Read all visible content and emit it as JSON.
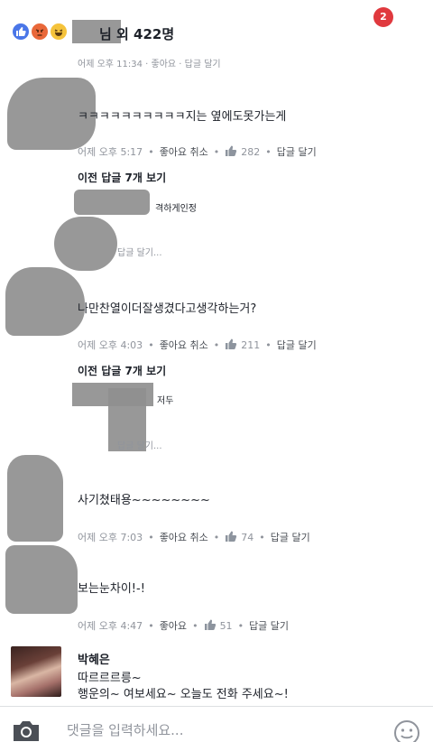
{
  "header": {
    "reaction_icons": [
      "like-icon",
      "angry-icon",
      "haha-icon"
    ],
    "text": "님 외 422명",
    "notification_count": "2",
    "sub_meta": "어제 오후 11:34 · 좋아요 · 답글 달기"
  },
  "comments": [
    {
      "text": "ㅋㅋㅋㅋㅋㅋㅋㅋㅋㅋ지는 옆에도못가는게",
      "time": "어제 오후 5:17",
      "like_label": "좋아요 취소",
      "likes": "282",
      "reply_label": "답글 달기",
      "more_replies": "이전 답글 7개 보기",
      "reply_preview": "격하게인정",
      "reply_meta": "답글 달기..."
    },
    {
      "text": "나만찬열이더잘생겼다고생각하는거?",
      "time": "어제 오후 4:03",
      "like_label": "좋아요 취소",
      "likes": "211",
      "reply_label": "답글 달기",
      "more_replies": "이전 답글 7개 보기",
      "reply_preview": "저두",
      "reply_meta": "답글 달기..."
    },
    {
      "text": "사기쳤태용~~~~~~~~",
      "time": "어제 오후 7:03",
      "like_label": "좋아요 취소",
      "likes": "74",
      "reply_label": "답글 달기"
    },
    {
      "text": "보는눈차이!-!",
      "time": "어제 오후 4:47",
      "like_label": "좋아요",
      "likes": "51",
      "reply_label": "답글 달기"
    }
  ],
  "last_comment": {
    "author": "박혜은",
    "lines": [
      "따르르르릉~",
      "행운의~ 여보세요~ 오늘도 전화 주세요~!"
    ]
  },
  "composer": {
    "placeholder": "댓글을 입력하세요...",
    "camera_icon": "camera-icon",
    "emoji_icon": "smiley-icon"
  },
  "colors": {
    "like_blue": "#4a76e8",
    "meta_gray": "#90949c",
    "badge_red": "#e0393e"
  }
}
